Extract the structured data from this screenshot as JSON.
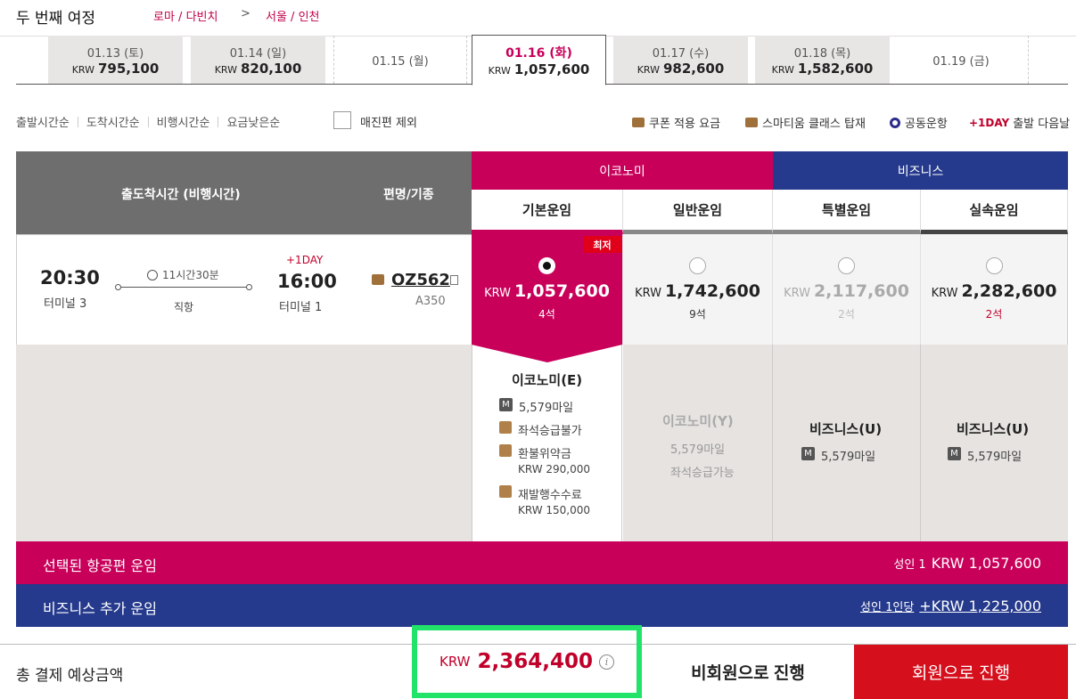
{
  "header": {
    "title": "두 번째 여정",
    "origin": "로마 / 다빈치",
    "arrow": ">",
    "destination": "서울 / 인천"
  },
  "date_tabs": [
    {
      "date": "01.13 (토)",
      "currency": "KRW",
      "price": "795,100",
      "state": "available"
    },
    {
      "date": "01.14 (일)",
      "currency": "KRW",
      "price": "820,100",
      "state": "available"
    },
    {
      "date": "01.15 (월)",
      "currency": "",
      "price": "",
      "state": "empty"
    },
    {
      "date": "01.16 (화)",
      "currency": "KRW",
      "price": "1,057,600",
      "state": "selected"
    },
    {
      "date": "01.17 (수)",
      "currency": "KRW",
      "price": "982,600",
      "state": "available"
    },
    {
      "date": "01.18 (목)",
      "currency": "KRW",
      "price": "1,582,600",
      "state": "available"
    },
    {
      "date": "01.19 (금)",
      "currency": "",
      "price": "",
      "state": "empty"
    }
  ],
  "sort": {
    "options": [
      "출발시간순",
      "도착시간순",
      "비행시간순",
      "요금낮은순"
    ],
    "exclude_soldout": "매진편 제외"
  },
  "legend": {
    "coupon": "쿠폰 적용 요금",
    "smartium": "스마티움 클래스 탑재",
    "codeshare": "공동운항",
    "oneday_tag": "+1DAY",
    "oneday_text": "출발 다음날"
  },
  "table": {
    "col_time": "출도착시간 (비행시간)",
    "col_flight": "편명/기종",
    "economy": "이코노미",
    "business": "비즈니스",
    "fare_types": [
      "기본운임",
      "일반운임",
      "특별운임",
      "실속운임"
    ]
  },
  "flight": {
    "dep_time": "20:30",
    "dep_terminal": "터미널 3",
    "duration": "11시간30분",
    "stops": "직항",
    "next_day": "+1DAY",
    "arr_time": "16:00",
    "arr_terminal": "터미널 1",
    "flight_no": "OZ562",
    "aircraft": "A350",
    "lowest_badge": "최저",
    "fares": [
      {
        "currency": "KRW",
        "price": "1,057,600",
        "seats": "4석",
        "selected": true
      },
      {
        "currency": "KRW",
        "price": "1,742,600",
        "seats": "9석",
        "selected": false
      },
      {
        "currency": "KRW",
        "price": "2,117,600",
        "seats": "2석",
        "selected": false
      },
      {
        "currency": "KRW",
        "price": "2,282,600",
        "seats": "2석",
        "selected": false
      }
    ]
  },
  "details": {
    "selected": {
      "cabin": "이코노미(E)",
      "miles": "5,579마일",
      "upgrade": "좌석승급불가",
      "refund_label": "환불위약금",
      "refund_amount": "KRW 290,000",
      "reissue_label": "재발행수수료",
      "reissue_amount": "KRW 150,000"
    },
    "general": {
      "cabin": "이코노미(Y)",
      "miles": "5,579마일",
      "upgrade": "좌석승급가능"
    },
    "special": {
      "cabin": "비즈니스(U)",
      "miles": "5,579마일"
    },
    "saver": {
      "cabin": "비즈니스(U)",
      "miles": "5,579마일"
    }
  },
  "summary": {
    "selected_label": "선택된 항공편 운임",
    "selected_pax": "성인 1",
    "selected_value": "KRW 1,057,600",
    "biz_label": "비즈니스 추가 운임",
    "biz_pax": "성인 1인당",
    "biz_value": "+KRW 1,225,000"
  },
  "footer": {
    "total_label": "총 결제 예상금액",
    "currency": "KRW",
    "total": "2,364,400",
    "info_icon": "i",
    "guest_button": "비회원으로 진행",
    "member_button": "회원으로 진행"
  },
  "colors": {
    "economy": "#c8005a",
    "business": "#253a8c",
    "member_button": "#d50f1c",
    "highlight": "#21e36a"
  }
}
